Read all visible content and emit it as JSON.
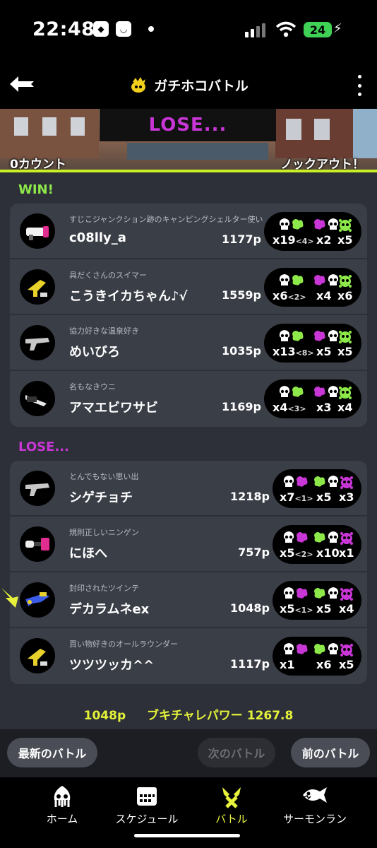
{
  "status_bar": {
    "time": "22:48",
    "battery": "24"
  },
  "header": {
    "title": "ガチホコバトル"
  },
  "banner": {
    "result": "LOSE...",
    "left_count": "0カウント",
    "right_count": "ノックアウト！"
  },
  "win_team": {
    "label": "WIN!",
    "players": [
      {
        "title": "すじこジャンクション跡のキャンピングシェルター使い",
        "name": "c08lly_a",
        "points": "1177p",
        "kills": "x19",
        "assists": "<4>",
        "specials_hit": "x2",
        "special": "x5",
        "weapon": "shelter"
      },
      {
        "title": "具だくさんのスイマー",
        "name": "こうきイカちゃん♪√",
        "points": "1559p",
        "kills": "x6",
        "assists": "<2>",
        "specials_hit": "x4",
        "special": "x6",
        "weapon": "shooter"
      },
      {
        "title": "協力好きな温泉好き",
        "name": "めいびろ",
        "points": "1035p",
        "kills": "x13",
        "assists": "<8>",
        "specials_hit": "x5",
        "special": "x5",
        "weapon": "blaster"
      },
      {
        "title": "名もなきウニ",
        "name": "アマエビワサビ",
        "points": "1169p",
        "kills": "x4",
        "assists": "<3>",
        "specials_hit": "x3",
        "special": "x4",
        "weapon": "splatling"
      }
    ]
  },
  "lose_team": {
    "label": "LOSE...",
    "players": [
      {
        "title": "とんでもない思い出",
        "name": "シゲチョチ",
        "points": "1218p",
        "kills": "x7",
        "assists": "<1>",
        "specials_hit": "x5",
        "special": "x3",
        "weapon": "blaster"
      },
      {
        "title": "規則正しいニンゲン",
        "name": "にほへ",
        "points": "757p",
        "kills": "x5",
        "assists": "<2>",
        "specials_hit": "x10",
        "special": "x1",
        "weapon": "roller"
      },
      {
        "title": "封印されたツインテ",
        "name": "デカラムネex",
        "points": "1048p",
        "kills": "x5",
        "assists": "<1>",
        "specials_hit": "x5",
        "special": "x4",
        "weapon": "nzap"
      },
      {
        "title": "買い物好きのオールラウンダー",
        "name": "ツツツッカ^^",
        "points": "1117p",
        "kills": "x1",
        "assists": "",
        "specials_hit": "x6",
        "special": "x5",
        "weapon": "shooter"
      }
    ]
  },
  "summary": {
    "points": "1048p",
    "power_label": "ブキチャレパワー",
    "power_value": "1267.8"
  },
  "nav": {
    "latest": "最新のバトル",
    "next": "次のバトル",
    "prev": "前のバトル"
  },
  "tabs": [
    {
      "label": "ホーム"
    },
    {
      "label": "スケジュール"
    },
    {
      "label": "バトル"
    },
    {
      "label": "サーモンラン"
    }
  ],
  "colors": {
    "accent_green": "#c8f025",
    "lose_purple": "#c836d6",
    "win_green": "#8de84a",
    "highlight_yellow": "#e8f23c"
  }
}
